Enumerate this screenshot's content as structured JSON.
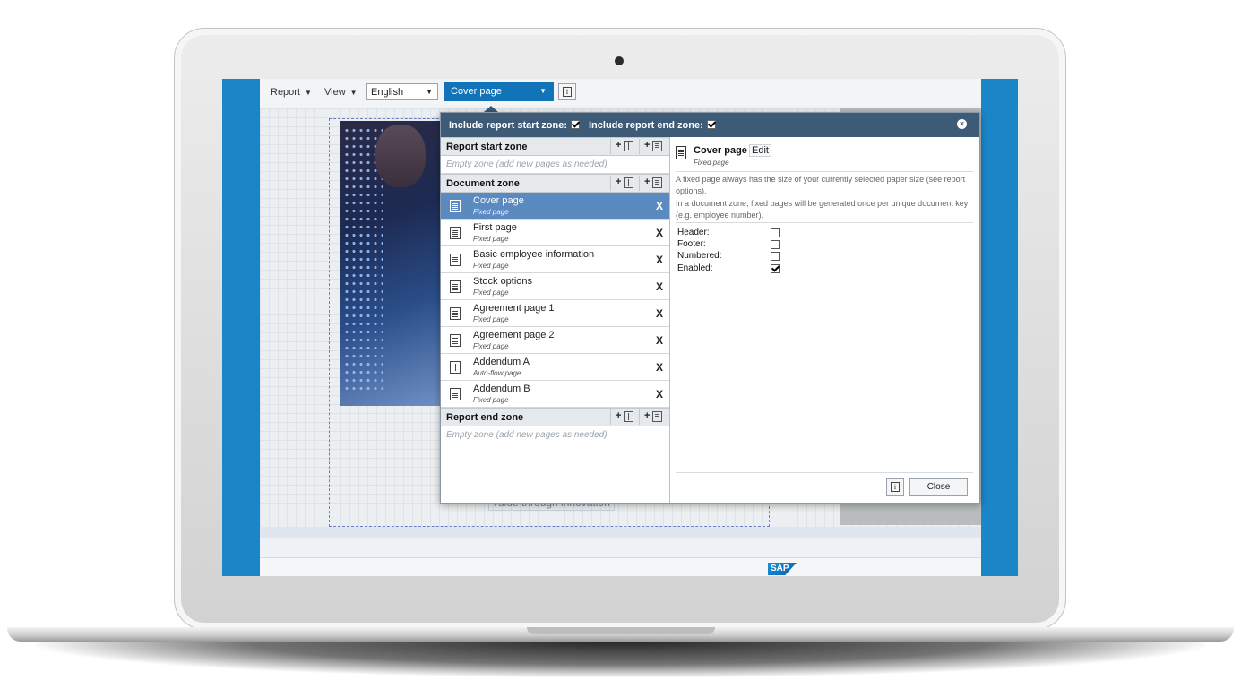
{
  "toolbar": {
    "report_label": "Report",
    "view_label": "View",
    "language_value": "English",
    "page_select_value": "Cover page",
    "caret": "▼",
    "info_glyph": "i"
  },
  "canvas": {
    "bottom_text": "value through innovation",
    "logo_text": "SAP"
  },
  "dialog": {
    "include_start_label": "Include report start zone:",
    "include_start_checked": true,
    "include_end_label": "Include report end zone:",
    "include_end_checked": true,
    "close_glyph": "×",
    "add_glyph": "+",
    "zones": {
      "start_title": "Report start zone",
      "start_empty": "Empty zone (add new pages as needed)",
      "document_title": "Document zone",
      "end_title": "Report end zone",
      "end_empty": "Empty zone (add new pages as needed)"
    },
    "pages": [
      {
        "name": "Cover page",
        "type": "Fixed page",
        "icon": "fixed-page-icon",
        "selected": true
      },
      {
        "name": "First page",
        "type": "Fixed page",
        "icon": "fixed-page-icon",
        "selected": false
      },
      {
        "name": "Basic employee information",
        "type": "Fixed page",
        "icon": "fixed-page-icon",
        "selected": false
      },
      {
        "name": "Stock options",
        "type": "Fixed page",
        "icon": "fixed-page-icon",
        "selected": false
      },
      {
        "name": "Agreement page 1",
        "type": "Fixed page",
        "icon": "fixed-page-icon",
        "selected": false
      },
      {
        "name": "Agreement page 2",
        "type": "Fixed page",
        "icon": "fixed-page-icon",
        "selected": false
      },
      {
        "name": "Addendum A",
        "type": "Auto-flow page",
        "icon": "auto-flow-page-icon",
        "selected": false
      },
      {
        "name": "Addendum B",
        "type": "Fixed page",
        "icon": "fixed-page-icon",
        "selected": false
      }
    ],
    "remove_glyph": "X",
    "detail": {
      "title": "Cover page",
      "edit_label": "Edit",
      "type": "Fixed page",
      "desc1": "A fixed page always has the size of your currently selected paper size (see report options).",
      "desc2": "In a document zone, fixed pages will be generated once per unique document key (e.g. employee number).",
      "props": [
        {
          "label": "Header:",
          "checked": false
        },
        {
          "label": "Footer:",
          "checked": false
        },
        {
          "label": "Numbered:",
          "checked": false
        },
        {
          "label": "Enabled:",
          "checked": true
        }
      ],
      "close_label": "Close"
    }
  },
  "colors": {
    "screen_blue": "#1a86c8",
    "dialog_header": "#3d5a76",
    "selected_row": "#5a8ac0",
    "page_select": "#1173b8"
  }
}
